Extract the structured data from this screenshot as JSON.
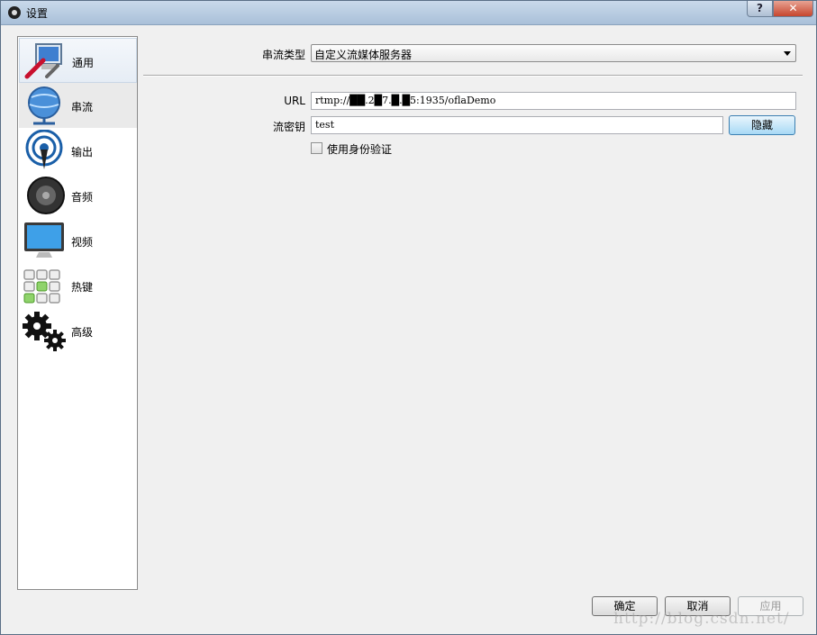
{
  "window": {
    "title": "设置"
  },
  "titlebar": {
    "help_label": "?",
    "close_label": "✕"
  },
  "sidebar": {
    "items": [
      {
        "label": "通用",
        "icon": "general-settings-icon"
      },
      {
        "label": "串流",
        "icon": "globe-network-icon"
      },
      {
        "label": "输出",
        "icon": "broadcast-antenna-icon"
      },
      {
        "label": "音频",
        "icon": "speaker-icon"
      },
      {
        "label": "视频",
        "icon": "monitor-icon"
      },
      {
        "label": "热键",
        "icon": "keyboard-icon"
      },
      {
        "label": "高级",
        "icon": "gears-icon"
      }
    ]
  },
  "stream": {
    "type_label": "串流类型",
    "type_value": "自定义流媒体服务器",
    "url_label": "URL",
    "url_value": "rtmp://██.2█7.█.█5:1935/oflaDemo",
    "key_label": "流密钥",
    "key_value": "test",
    "hide_label": "隐藏",
    "auth_label": "使用身份验证"
  },
  "footer": {
    "ok_label": "确定",
    "cancel_label": "取消",
    "apply_label": "应用"
  },
  "watermark": "http://blog.csdn.net/"
}
